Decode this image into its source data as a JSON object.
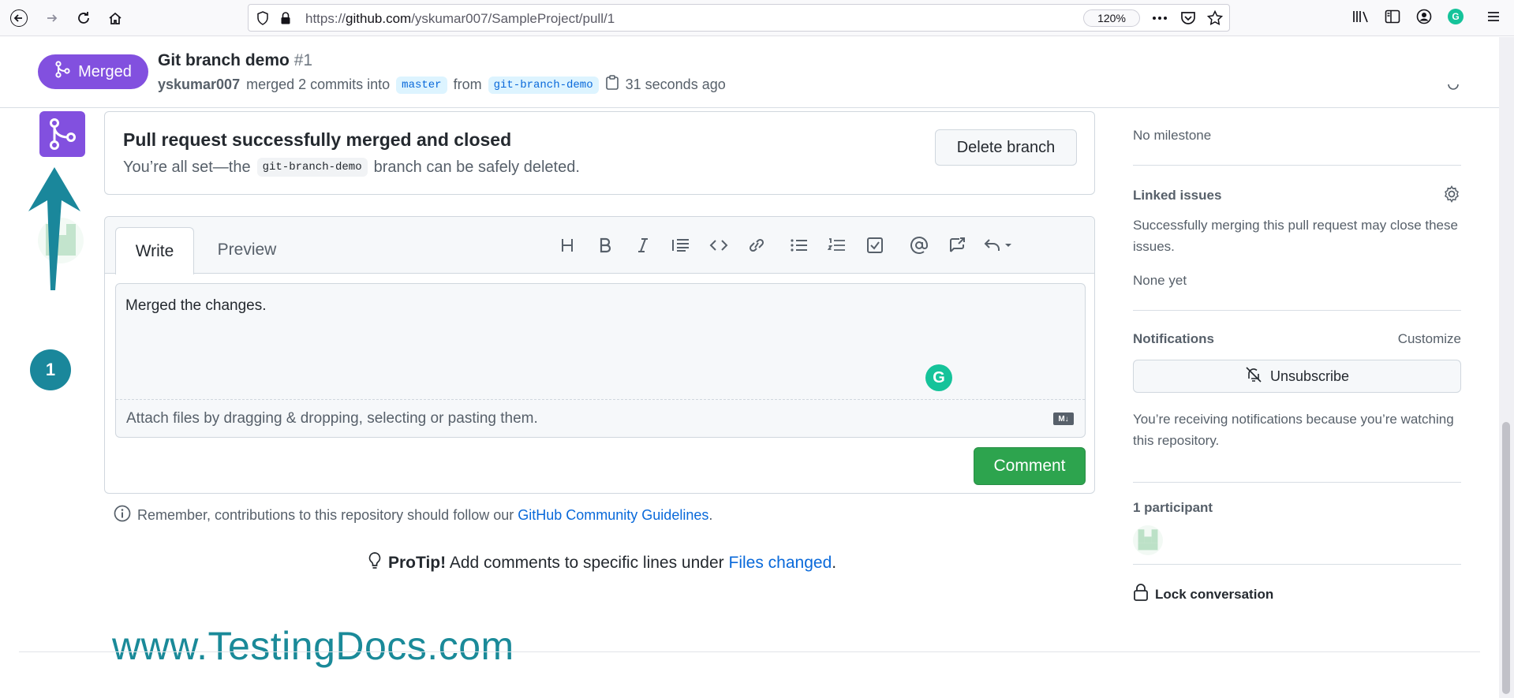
{
  "browser": {
    "url_prefix": "https://",
    "url_domain": "github.com",
    "url_path": "/yskumar007/SampleProject/pull/1",
    "zoom": "120%",
    "profile_initial": "G"
  },
  "pr": {
    "state_label": "Merged",
    "title": "Git branch demo",
    "number": "#1",
    "author": "yskumar007",
    "meta_action": "merged 2 commits into",
    "base_branch": "master",
    "from_word": "from",
    "head_branch": "git-branch-demo",
    "time_ago": "31 seconds ago"
  },
  "merge_event": {
    "title": "Pull request successfully merged and closed",
    "desc_prefix": "You’re all set—the",
    "branch": "git-branch-demo",
    "desc_suffix": "branch can be safely deleted.",
    "delete_button": "Delete branch"
  },
  "comment": {
    "tab_write": "Write",
    "tab_preview": "Preview",
    "tools": [
      "heading-icon",
      "bold-icon",
      "italic-icon",
      "quote-icon",
      "code-icon",
      "link-icon",
      "bullet-list-icon",
      "numbered-list-icon",
      "task-list-icon",
      "mention-icon",
      "reference-icon",
      "reply-icon"
    ],
    "text": "Merged the changes.",
    "grammarly_initial": "G",
    "attach_text": "Attach files by dragging & dropping, selecting or pasting them.",
    "submit_label": "Comment"
  },
  "footnote": {
    "guidelines_prefix": "Remember, contributions to this repository should follow our",
    "guidelines_link": "GitHub Community Guidelines",
    "guidelines_suffix": ".",
    "protip_label": "ProTip!",
    "protip_text": "Add comments to specific lines under",
    "protip_link": "Files changed",
    "protip_suffix": "."
  },
  "sidebar": {
    "milestone_text": "No milestone",
    "linked_issues_heading": "Linked issues",
    "linked_issues_desc": "Successfully merging this pull request may close these issues.",
    "linked_issues_value": "None yet",
    "notifications_heading": "Notifications",
    "customize_link": "Customize",
    "unsubscribe_label": "Unsubscribe",
    "notifications_desc": "You’re receiving notifications because you’re watching this repository.",
    "participants_heading": "1 participant",
    "lock_label": "Lock conversation"
  },
  "annotation": {
    "step_number": "1",
    "watermark": "www.TestingDocs.com"
  },
  "colors": {
    "merged_purple": "#8250df",
    "comment_green": "#2da44e",
    "annotation_teal": "#1a879b",
    "link_blue": "#0969da"
  }
}
